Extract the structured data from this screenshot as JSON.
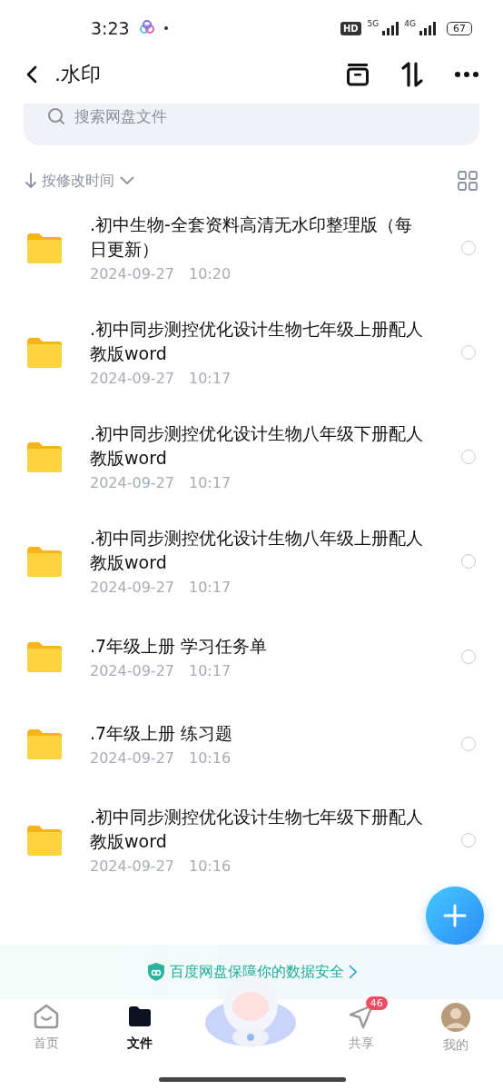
{
  "status_bar": {
    "time": "3:23",
    "hd": "HD",
    "network_1": "5G",
    "network_2": "4G",
    "battery": "67"
  },
  "header": {
    "title": ".水印"
  },
  "search": {
    "placeholder": "搜索网盘文件"
  },
  "sort": {
    "label": "按修改时间"
  },
  "files": [
    {
      "title": ".初中生物-全套资料高清无水印整理版（每日更新）",
      "date": "2024-09-27",
      "time": "10:20",
      "selected": false
    },
    {
      "title": ".初中同步测控优化设计生物七年级上册配人教版word",
      "date": "2024-09-27",
      "time": "10:17",
      "selected": false
    },
    {
      "title": ".初中同步测控优化设计生物八年级下册配人教版word",
      "date": "2024-09-27",
      "time": "10:17",
      "selected": false
    },
    {
      "title": ".初中同步测控优化设计生物八年级上册配人教版word",
      "date": "2024-09-27",
      "time": "10:17",
      "selected": false
    },
    {
      "title": ".7年级上册 学习任务单",
      "date": "2024-09-27",
      "time": "10:17",
      "selected": false
    },
    {
      "title": ".7年级上册 练习题",
      "date": "2024-09-27",
      "time": "10:16",
      "selected": false
    },
    {
      "title": ".初中同步测控优化设计生物七年级下册配人教版word",
      "date": "2024-09-27",
      "time": "10:16",
      "selected": false
    }
  ],
  "banner": {
    "text": "百度网盘保障你的数据安全"
  },
  "tabs": [
    {
      "kind": "home",
      "label": "首页",
      "selected": false
    },
    {
      "kind": "files",
      "label": "文件",
      "selected": true
    },
    {
      "kind": "mascot"
    },
    {
      "kind": "share",
      "label": "共享",
      "selected": false,
      "badge": "46"
    },
    {
      "kind": "me",
      "label": "我的",
      "selected": false
    }
  ]
}
